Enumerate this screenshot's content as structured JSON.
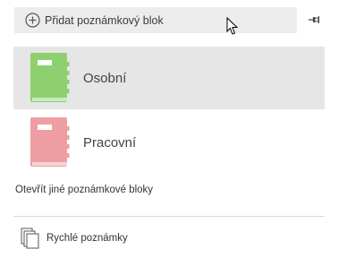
{
  "add_notebook": {
    "label": "Přidat poznámkový blok",
    "icon": "plus-circle-icon"
  },
  "pin": {
    "icon": "pin-icon"
  },
  "notebooks": [
    {
      "name": "Osobní",
      "color": "#8ed06f",
      "selected": true
    },
    {
      "name": "Pracovní",
      "color": "#ee9ea2",
      "selected": false
    }
  ],
  "open_other": {
    "label": "Otevřít jiné poznámkové bloky"
  },
  "quick_notes": {
    "label": "Rychlé poznámky",
    "icon": "quick-notes-icon"
  }
}
